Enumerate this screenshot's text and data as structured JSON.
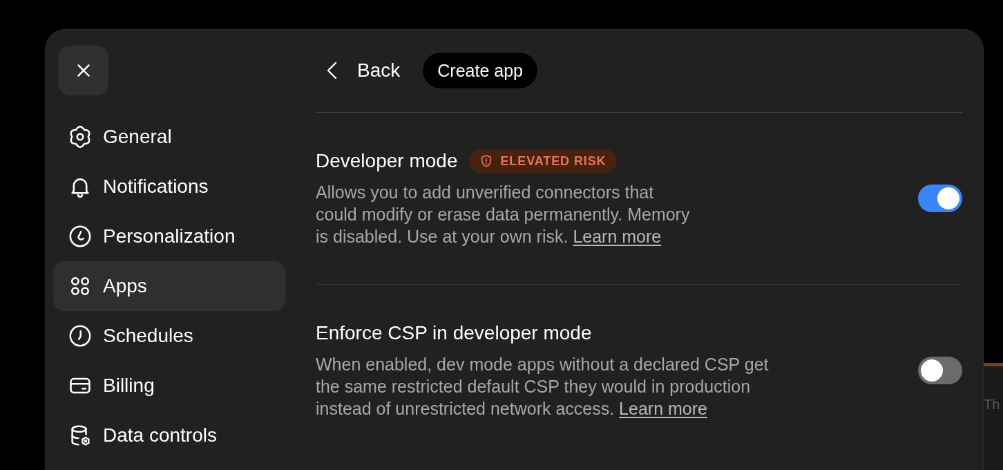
{
  "sidebar": {
    "items": [
      {
        "label": "General",
        "selected": false
      },
      {
        "label": "Notifications",
        "selected": false
      },
      {
        "label": "Personalization",
        "selected": false
      },
      {
        "label": "Apps",
        "selected": true
      },
      {
        "label": "Schedules",
        "selected": false
      },
      {
        "label": "Billing",
        "selected": false
      },
      {
        "label": "Data controls",
        "selected": false
      }
    ]
  },
  "header": {
    "back": "Back",
    "create_button": "Create app"
  },
  "settings": [
    {
      "title": "Developer mode",
      "badge": "ELEVATED RISK",
      "description": "Allows you to add unverified connectors that could modify or erase data permanently. Memory is disabled. Use at your own risk.",
      "link": "Learn more",
      "on": true
    },
    {
      "title": "Enforce CSP in developer mode",
      "description": "When enabled, dev mode apps without a declared CSP get the same restricted default CSP they would in production instead of unrestricted network access.",
      "link": "Learn more",
      "on": false
    }
  ],
  "backdrop": {
    "text": "Th"
  }
}
